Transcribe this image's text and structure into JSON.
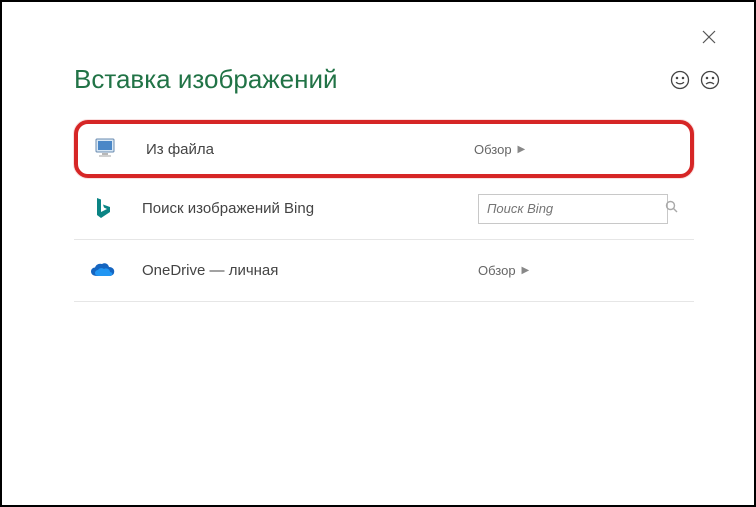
{
  "title": "Вставка изображений",
  "options": {
    "file": {
      "label": "Из файла",
      "action": "Обзор"
    },
    "bing": {
      "label": "Поиск изображений Bing",
      "placeholder": "Поиск Bing"
    },
    "onedrive": {
      "label": "OneDrive — личная",
      "action": "Обзор"
    }
  }
}
